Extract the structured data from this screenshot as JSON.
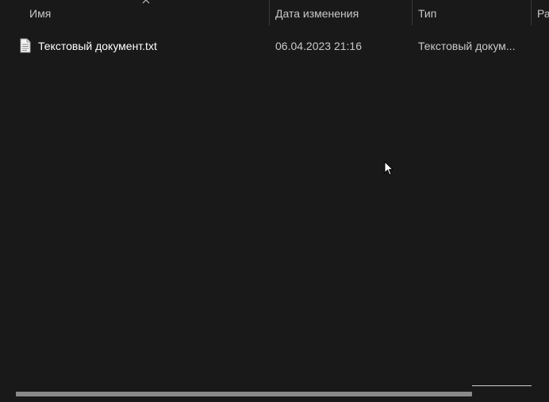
{
  "columns": {
    "name": "Имя",
    "date_modified": "Дата изменения",
    "type": "Тип",
    "size_partial": "Ра"
  },
  "sort": {
    "column": "name",
    "icon": "chevron-up-icon"
  },
  "files": [
    {
      "icon": "text-file-icon",
      "name": "Текстовый документ.txt",
      "date_modified": "06.04.2023 21:16",
      "type": "Текстовый докум..."
    }
  ],
  "colors": {
    "background": "#191919",
    "header_text": "#c8c8c8",
    "row_text_primary": "#ffffff",
    "row_text_secondary": "#c9c9c9",
    "scrollbar_thumb": "#8a8a8a"
  }
}
